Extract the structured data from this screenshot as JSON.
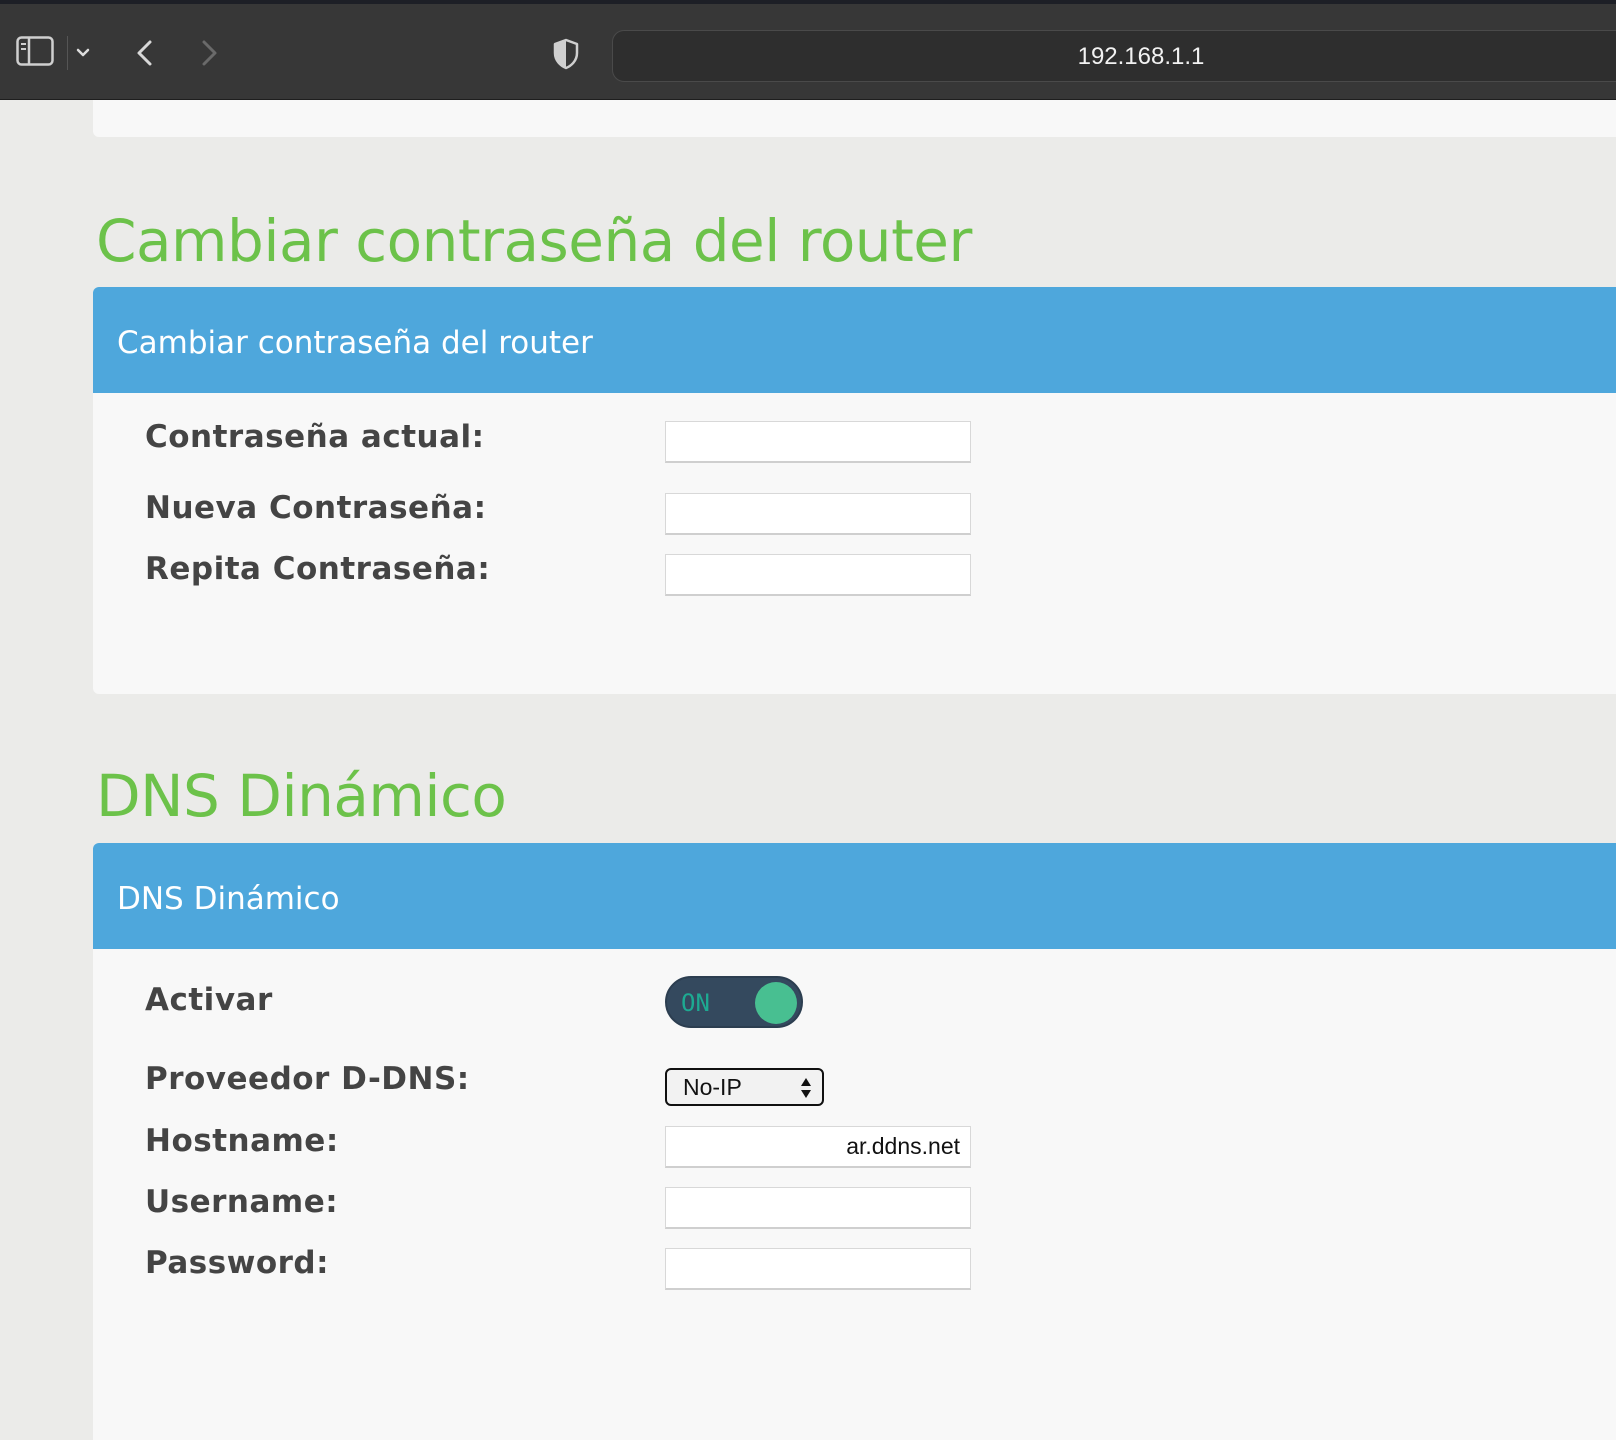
{
  "browser": {
    "url": "192.168.1.1"
  },
  "password_section": {
    "title": "Cambiar contraseña del router",
    "panel_header": "Cambiar contraseña del router",
    "fields": [
      {
        "label": "Contraseña actual:",
        "value": ""
      },
      {
        "label": "Nueva Contraseña:",
        "value": ""
      },
      {
        "label": "Repita Contraseña:",
        "value": ""
      }
    ]
  },
  "ddns_section": {
    "title": "DNS Dinámico",
    "panel_header": "DNS Dinámico",
    "activate": {
      "label": "Activar",
      "state": "ON"
    },
    "provider": {
      "label": "Proveedor D-DNS:",
      "value": "No-IP"
    },
    "hostname": {
      "label": "Hostname:",
      "value": "ar.ddns.net"
    },
    "username": {
      "label": "Username:",
      "value": ""
    },
    "password": {
      "label": "Password:",
      "value": ""
    }
  },
  "colors": {
    "title_green": "#6cc24a",
    "header_blue": "#4ea7dc",
    "toggle_bg": "#34495e",
    "toggle_knob": "#48bf91"
  }
}
